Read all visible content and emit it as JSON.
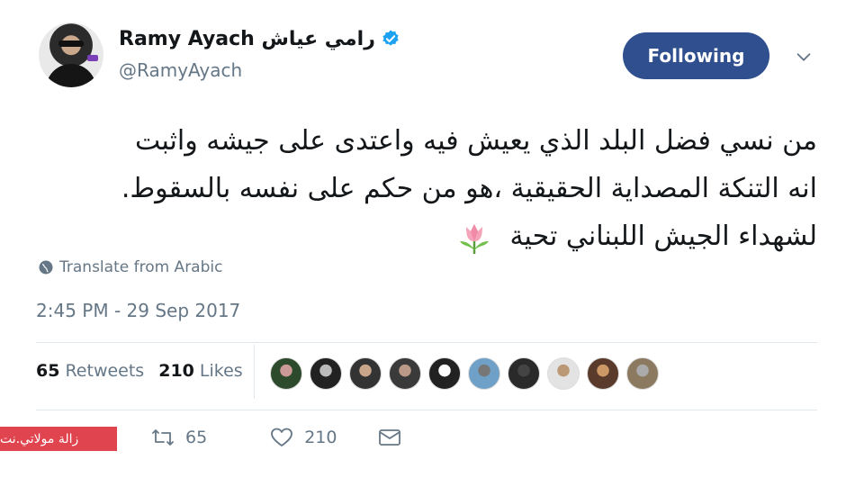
{
  "user": {
    "name": "Ramy Ayach رامي عياش",
    "handle": "@RamyAyach",
    "verified_icon": "verified-badge-icon"
  },
  "header": {
    "follow_label": "Following",
    "more_icon": "chevron-down-icon"
  },
  "tweet": {
    "lines": [
      "من نسي فضل البلد الذي يعيش فيه واعتدى على جيشه واثبت",
      "انه التنكة المصداية الحقيقية ،هو من حكم على نفسه بالسقوط.",
      "لشهداء الجيش اللبناني تحية"
    ],
    "emoji_icon": "tulip-icon",
    "translate_label": "Translate from Arabic",
    "timestamp": "2:45 PM - 29 Sep 2017"
  },
  "stats": {
    "retweets_count": "65",
    "retweets_label": "Retweets",
    "likes_count": "210",
    "likes_label": "Likes"
  },
  "actions": {
    "retweet_count": "65",
    "like_count": "210"
  },
  "watermark": "زالة مولاتي.نت",
  "colors": {
    "follow_button": "#2f4f8f",
    "secondary_text": "#657786",
    "verified": "#1da1f2",
    "watermark_bg": "#e0454f"
  }
}
